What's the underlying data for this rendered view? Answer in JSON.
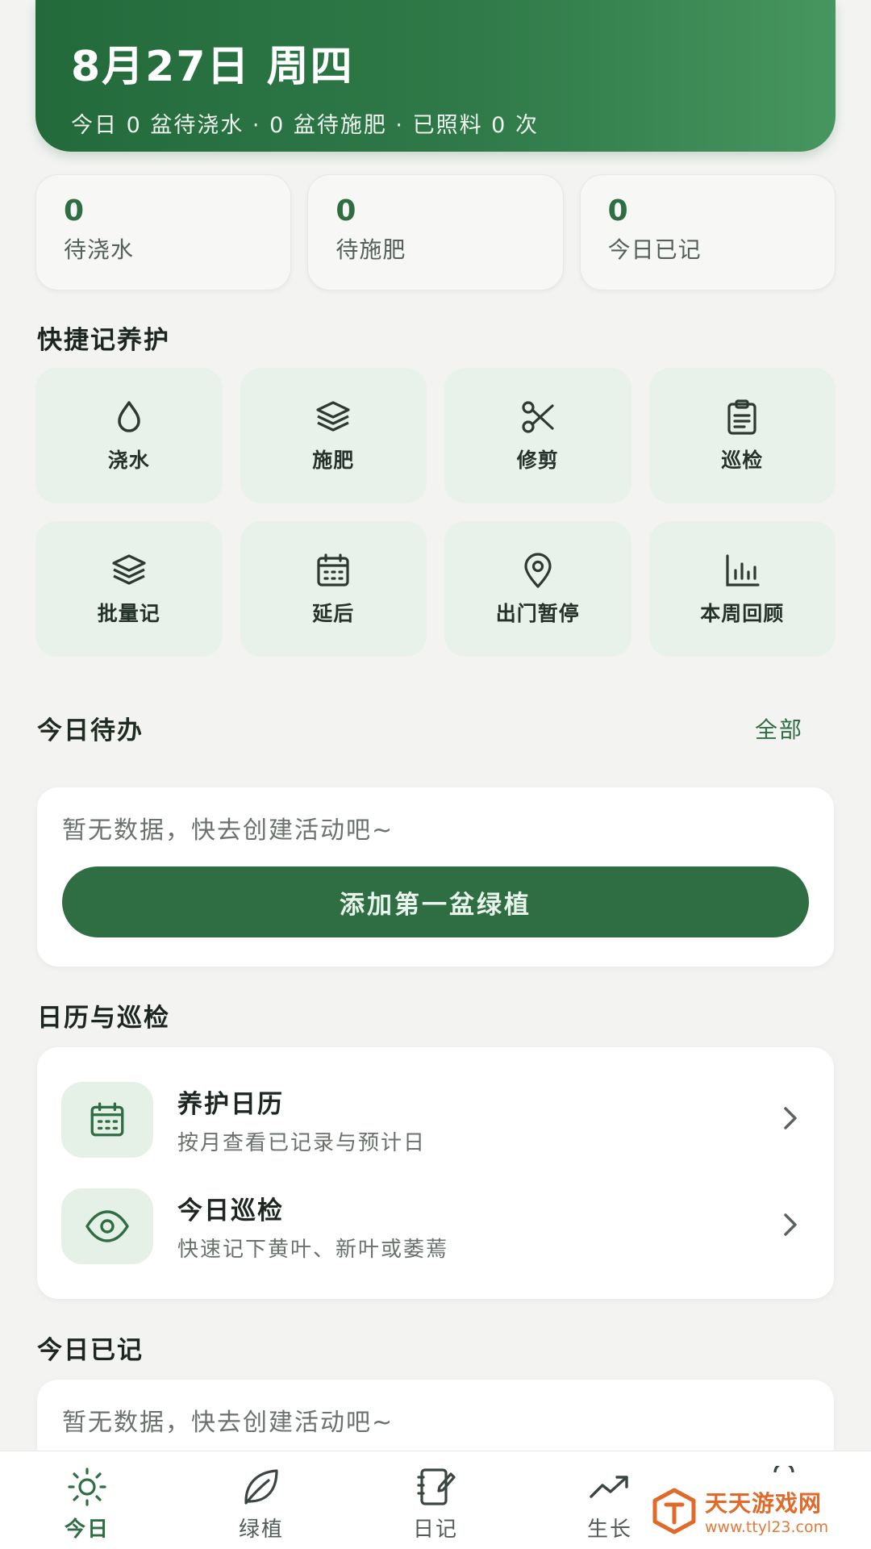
{
  "header": {
    "date": "8月27日 周四",
    "summary": "今日 0 盆待浇水 · 0 盆待施肥 · 已照料 0 次"
  },
  "stats": [
    {
      "value": "0",
      "label": "待浇水"
    },
    {
      "value": "0",
      "label": "待施肥"
    },
    {
      "value": "0",
      "label": "今日已记"
    }
  ],
  "quick_section": {
    "title": "快捷记养护"
  },
  "quick_actions": [
    {
      "label": "浇水",
      "icon": "water-drop-icon"
    },
    {
      "label": "施肥",
      "icon": "layers-icon"
    },
    {
      "label": "修剪",
      "icon": "scissors-icon"
    },
    {
      "label": "巡检",
      "icon": "clipboard-icon"
    },
    {
      "label": "批量记",
      "icon": "stack-icon"
    },
    {
      "label": "延后",
      "icon": "calendar-icon"
    },
    {
      "label": "出门暂停",
      "icon": "location-pin-icon"
    },
    {
      "label": "本周回顾",
      "icon": "bar-chart-icon"
    }
  ],
  "todo": {
    "title": "今日待办",
    "all_link": "全部",
    "empty_text": "暂无数据，快去创建活动吧~",
    "add_button": "添加第一盆绿植"
  },
  "calendar_section": {
    "title": "日历与巡检",
    "items": [
      {
        "title": "养护日历",
        "subtitle": "按月查看已记录与预计日",
        "icon": "calendar-icon"
      },
      {
        "title": "今日巡检",
        "subtitle": "快速记下黄叶、新叶或萎蔫",
        "icon": "eye-icon"
      }
    ]
  },
  "logged": {
    "title": "今日已记",
    "empty_text": "暂无数据，快去创建活动吧~"
  },
  "nav": [
    {
      "label": "今日",
      "icon": "sun-icon",
      "active": true
    },
    {
      "label": "绿植",
      "icon": "leaf-icon",
      "active": false
    },
    {
      "label": "日记",
      "icon": "notebook-icon",
      "active": false
    },
    {
      "label": "生长",
      "icon": "trend-up-icon",
      "active": false
    }
  ],
  "watermark": {
    "name": "天天游戏网",
    "url": "www.ttyl23.com"
  },
  "colors": {
    "primary": "#2f6e43",
    "tile": "#e8f1ea",
    "background": "#f3f4f2"
  }
}
